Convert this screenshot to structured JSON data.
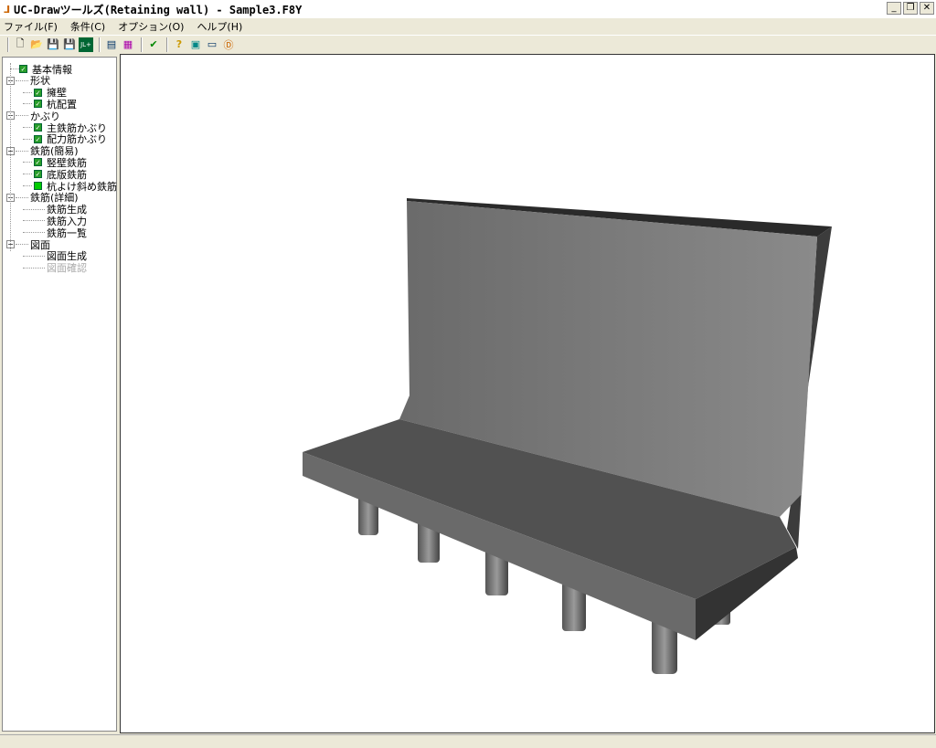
{
  "window": {
    "title": "UC-Drawツールズ(Retaining wall) - Sample3.F8Y",
    "minimize": "_",
    "restore": "❐",
    "close": "✕"
  },
  "menu": [
    "ファイル(F)",
    "条件(C)",
    "オプション(O)",
    "ヘルプ(H)"
  ],
  "toolbar": {
    "new": "🗋",
    "open": "📂",
    "save": "💾",
    "saveas": "💾",
    "export": "JL+",
    "view1": "▤",
    "view2": "▦",
    "check": "✔",
    "help": "?",
    "icon2": "▣",
    "icon3": "▭",
    "about": "Ⓓ"
  },
  "tree": [
    {
      "label": "基本情報",
      "level": 1,
      "check": "on"
    },
    {
      "label": "形状",
      "level": 0
    },
    {
      "label": "擁壁",
      "level": 2,
      "check": "on"
    },
    {
      "label": "杭配置",
      "level": 2,
      "check": "on"
    },
    {
      "label": "かぶり",
      "level": 0
    },
    {
      "label": "主鉄筋かぶり",
      "level": 2,
      "check": "on"
    },
    {
      "label": "配力筋かぶり",
      "level": 2,
      "check": "on"
    },
    {
      "label": "鉄筋(簡易)",
      "level": 0
    },
    {
      "label": "竪壁鉄筋",
      "level": 2,
      "check": "on"
    },
    {
      "label": "底版鉄筋",
      "level": 2,
      "check": "on"
    },
    {
      "label": "杭よけ斜め鉄筋",
      "level": 2,
      "check": "plain"
    },
    {
      "label": "鉄筋(詳細)",
      "level": 0
    },
    {
      "label": "鉄筋生成",
      "level": 3
    },
    {
      "label": "鉄筋入力",
      "level": 3
    },
    {
      "label": "鉄筋一覧",
      "level": 3
    },
    {
      "label": "図面",
      "level": 0
    },
    {
      "label": "図面生成",
      "level": 3
    },
    {
      "label": "図面確認",
      "level": 3,
      "disabled": true
    }
  ]
}
